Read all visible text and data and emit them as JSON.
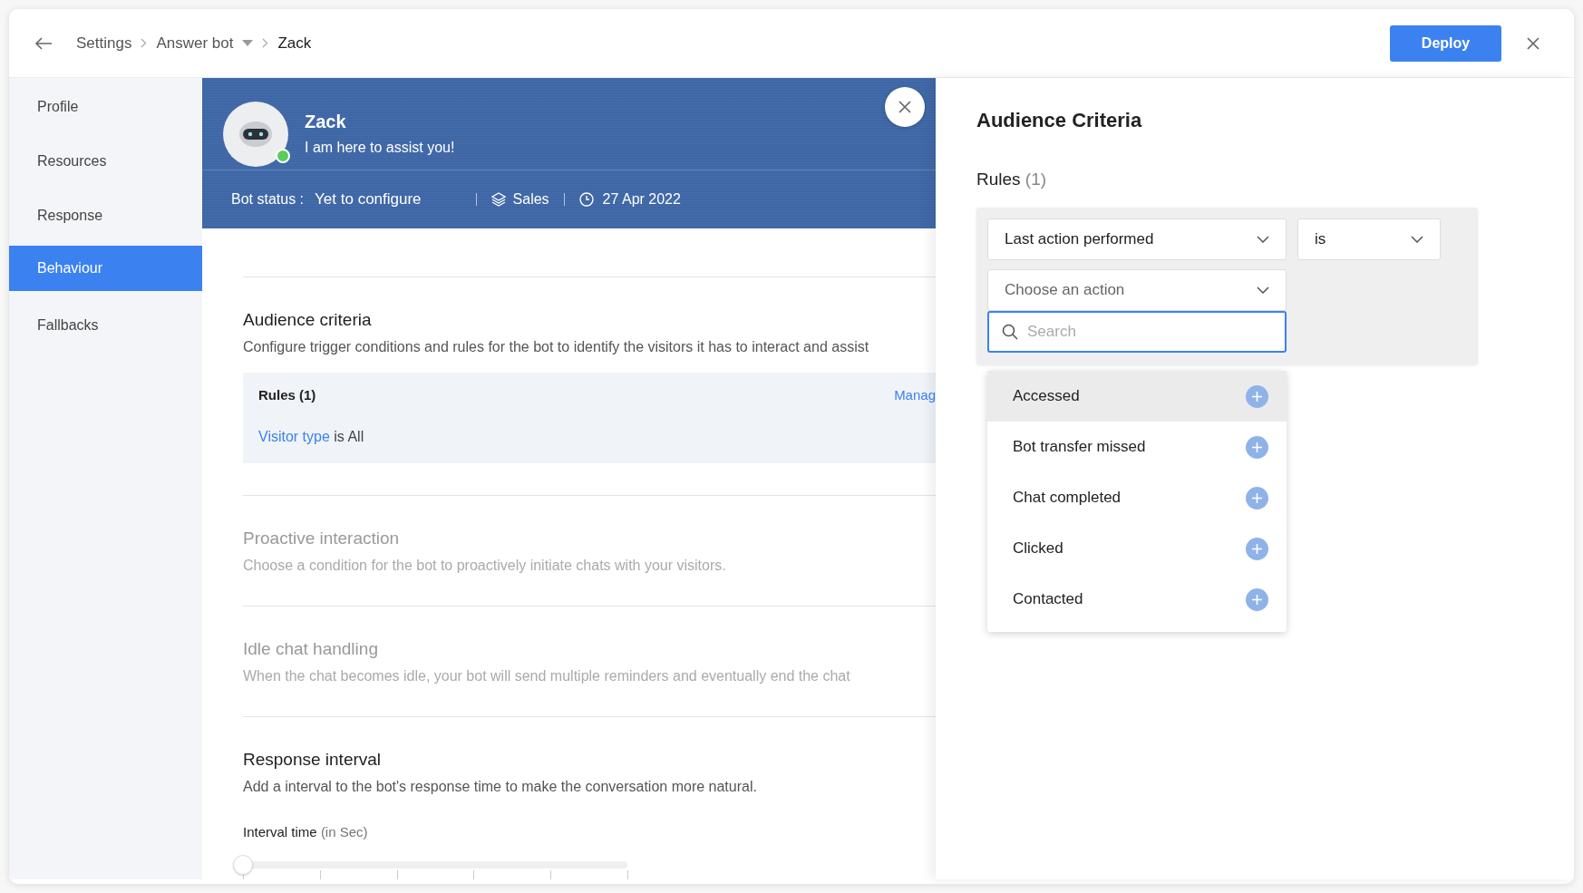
{
  "header": {
    "breadcrumb": [
      {
        "label": "Settings",
        "has_menu": false
      },
      {
        "label": "Answer bot",
        "has_menu": true
      },
      {
        "label": "Zack",
        "has_menu": false
      }
    ],
    "deploy_button": "Deploy"
  },
  "sidebar": {
    "items": [
      {
        "label": "Profile",
        "selected": false
      },
      {
        "label": "Resources",
        "selected": false
      },
      {
        "label": "Response",
        "selected": false
      },
      {
        "label": "Behaviour",
        "selected": true
      },
      {
        "label": "Fallbacks",
        "selected": false
      }
    ]
  },
  "bot": {
    "name": "Zack",
    "tagline": "I am here to assist you!",
    "online": true,
    "status_label": "Bot status :",
    "status_value": "Yet to configure",
    "department": "Sales",
    "date": "27 Apr 2022"
  },
  "sections": [
    {
      "kind": "rules",
      "title": "Audience criteria",
      "description": "Configure trigger conditions and rules for the bot to identify the visitors it has to interact and assist",
      "disabled": false,
      "rules_title": "Rules (1)",
      "manage_link": "Manag",
      "rule_field": "Visitor type",
      "rule_rest": " is All"
    },
    {
      "kind": "plain",
      "title": "Proactive interaction",
      "description": "Choose a condition for the bot to proactively initiate chats with your visitors.",
      "disabled": true
    },
    {
      "kind": "plain",
      "title": "Idle chat handling",
      "description": "When the chat becomes idle, your bot will send multiple reminders and eventually end the chat",
      "disabled": true
    },
    {
      "kind": "slider",
      "title": "Response interval",
      "description": "Add a interval to the bot's response time to make the conversation more natural.",
      "disabled": false,
      "slider_label": "Interval time",
      "slider_unit": "(in Sec)",
      "level": 0
    }
  ],
  "criteria_panel": {
    "title": "Audience Criteria",
    "rules_label": "Rules",
    "rules_count": "(1)",
    "field_select": "Last action performed",
    "operator_select": "is",
    "action_select": {
      "placeholder": "Choose an action"
    },
    "search": {
      "placeholder": "Search"
    },
    "options": [
      {
        "label": "Accessed",
        "highlighted": true
      },
      {
        "label": "Bot transfer missed",
        "highlighted": false
      },
      {
        "label": "Chat completed",
        "highlighted": false
      },
      {
        "label": "Clicked",
        "highlighted": false
      },
      {
        "label": "Contacted",
        "highlighted": false
      }
    ]
  }
}
